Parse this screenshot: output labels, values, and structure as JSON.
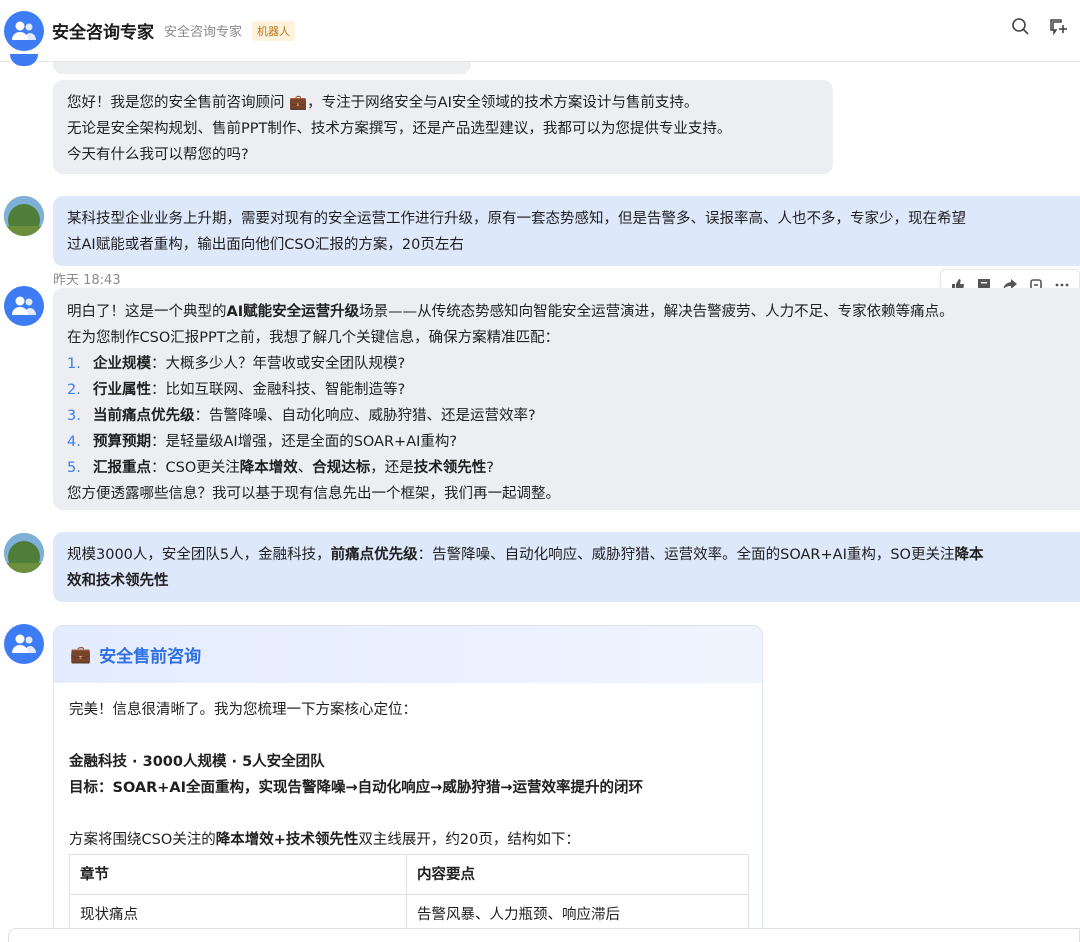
{
  "header": {
    "title": "安全咨询专家",
    "subtitle": "安全咨询专家",
    "badge": "机器人"
  },
  "messages": {
    "bot_intro": {
      "line1a": "您好！我是您的安全售前咨询顾问 ",
      "line1b": "，专注于网络安全与AI安全领域的技术方案设计与售前支持。",
      "line2": "无论是安全架构规划、售前PPT制作、技术方案撰写，还是产品选型建议，我都可以为您提供专业支持。",
      "line3": "今天有什么我可以帮您的吗?"
    },
    "user1": {
      "line1": "某科技型企业业务上升期，需要对现有的安全运营工作进行升级，原有一套态势感知，但是告警多、误报率高、人也不多，专家少，现在希望",
      "line2": "过AI赋能或者重构，输出面向他们CSO汇报的方案，20页左右"
    },
    "timestamp": "昨天 18:43",
    "bot2": {
      "l1a": "明白了！这是一个典型的",
      "l1b": "AI赋能安全运营升级",
      "l1c": "场景——从传统态势感知向智能安全运营演进，解决告警疲劳、人力不足、专家依赖等痛点。",
      "l2": "在为您制作CSO汇报PPT之前，我想了解几个关键信息，确保方案精准匹配：",
      "items": [
        {
          "num": "1.",
          "bold": "企业规模",
          "text": "：大概多少人？年营收或安全团队规模?"
        },
        {
          "num": "2.",
          "bold": "行业属性",
          "text": "：比如互联网、金融科技、智能制造等?"
        },
        {
          "num": "3.",
          "bold": "当前痛点优先级",
          "text": "：告警降噪、自动化响应、威胁狩猎、还是运营效率?"
        },
        {
          "num": "4.",
          "bold": "预算预期",
          "text": "：是轻量级AI增强，还是全面的SOAR+AI重构?"
        }
      ],
      "item5": {
        "num": "5.",
        "bold": "汇报重点",
        "t1": "：CSO更关注",
        "b1": "降本增效",
        "t2": "、",
        "b2": "合规达标",
        "t3": "，还是",
        "b3": "技术领先性",
        "t4": "?"
      },
      "last": "您方便透露哪些信息？我可以基于现有信息先出一个框架，我们再一起调整。"
    },
    "user2": {
      "l1a": "规模3000人，安全团队5人，金融科技，",
      "l1b": "前痛点优先级",
      "l1c": "：告警降噪、自动化响应、威胁狩猎、运营效率。全面的SOAR+AI重构，SO更关注",
      "l1d": "降本",
      "l2": "效和技术领先性"
    },
    "card": {
      "title": "安全售前咨询",
      "intro": "完美！信息很清晰了。我为您梳理一下方案核心定位：",
      "bold1": "金融科技 · 3000人规模 · 5人安全团队",
      "bold2": "目标：SOAR+AI全面重构，实现告警降噪→自动化响应→威胁狩猎→运营效率提升的闭环",
      "plan_a": "方案将围绕CSO关注的",
      "plan_b": "降本增效+技术领先性",
      "plan_c": "双主线展开，约20页，结构如下：",
      "table": {
        "headers": [
          "章节",
          "内容要点"
        ],
        "rows": [
          [
            "现状痛点",
            "告警风暴、人力瓶颈、响应滞后"
          ]
        ]
      }
    }
  },
  "colors": {
    "accent": "#3d7cf2",
    "user_bubble": "#dde8fb",
    "bot_bubble": "#eceef1"
  }
}
